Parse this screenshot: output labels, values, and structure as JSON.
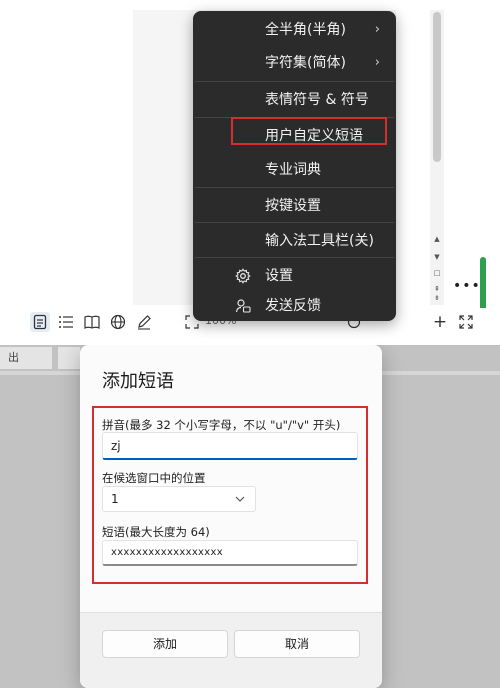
{
  "context_menu": {
    "items": [
      {
        "label": "全半角(半角)",
        "has_submenu": true,
        "icon": ""
      },
      {
        "label": "字符集(简体)",
        "has_submenu": true,
        "icon": ""
      },
      {
        "label": "表情符号 & 符号",
        "has_submenu": false,
        "icon": ""
      },
      {
        "label": "用户自定义短语",
        "has_submenu": false,
        "icon": "",
        "highlighted": true
      },
      {
        "label": "专业词典",
        "has_submenu": false,
        "icon": ""
      },
      {
        "label": "按键设置",
        "has_submenu": false,
        "icon": ""
      },
      {
        "label": "输入法工具栏(关)",
        "has_submenu": false,
        "icon": ""
      },
      {
        "label": "设置",
        "has_submenu": false,
        "icon": "gear-icon"
      },
      {
        "label": "发送反馈",
        "has_submenu": false,
        "icon": "feedback-icon"
      }
    ],
    "chevron": "›"
  },
  "toolbar": {
    "zoom_text": "100%",
    "more_label": "•••",
    "plus_label": "+",
    "expand_label": "⤢"
  },
  "background_app": {
    "tab_label": "出"
  },
  "dialog": {
    "title": "添加短语",
    "pinyin_label": "拼音(最多 32 个小写字母，不以 \"u\"/\"v\" 开头)",
    "pinyin_value": "zj",
    "position_label": "在候选窗口中的位置",
    "position_value": "1",
    "phrase_label": "短语(最大长度为 64)",
    "phrase_value": "xxxxxxxxxxxxxxxxxx",
    "add_button": "添加",
    "cancel_button": "取消"
  },
  "colors": {
    "menu_bg": "#2b2b2b",
    "highlight_red": "#d32f2f",
    "accent_blue": "#005fb8",
    "green_bar": "#2e9f4f"
  }
}
